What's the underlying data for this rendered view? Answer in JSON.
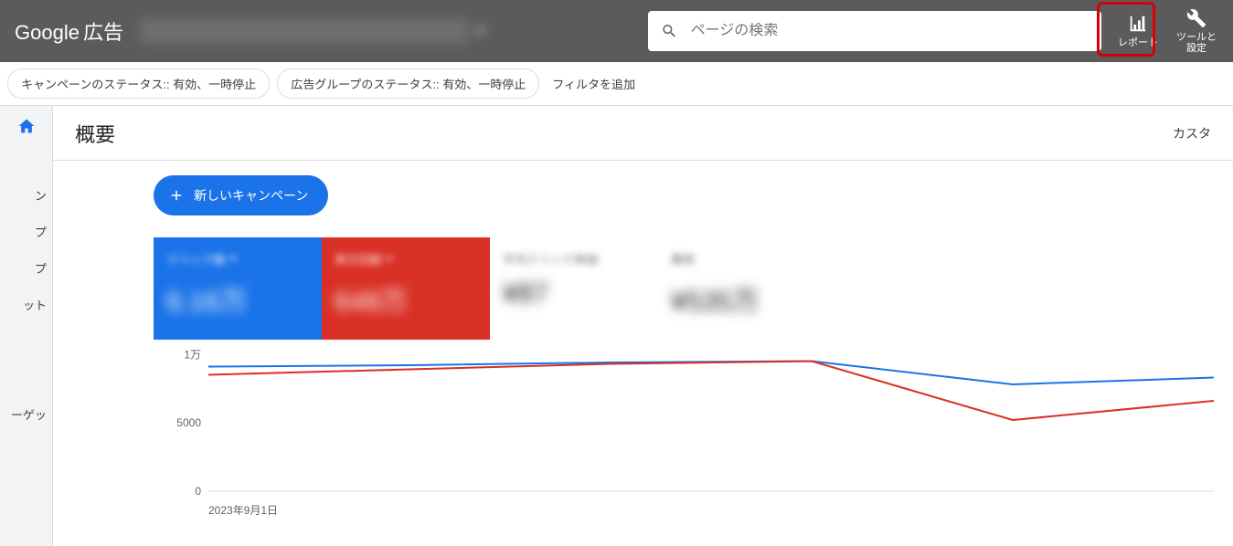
{
  "header": {
    "logo_google": "Google",
    "logo_ads": "広告",
    "search_placeholder": "ページの検索",
    "reports_label": "レポート",
    "tools_label": "ツールと\n設定"
  },
  "filters": {
    "chip_campaign": "キャンペーンのステータス:: 有効、一時停止",
    "chip_adgroup": "広告グループのステータス:: 有効、一時停止",
    "add_filter": "フィルタを追加"
  },
  "rail": {
    "items": [
      "ン",
      "プ",
      "プ",
      "ット",
      "ーゲッ"
    ]
  },
  "page": {
    "title": "概要",
    "customize": "カスタ",
    "new_campaign": "新しいキャンペーン"
  },
  "cards": [
    {
      "label": "クリック数",
      "value": "6.16万",
      "variant": "blue"
    },
    {
      "label": "表示回数",
      "value": "648万",
      "variant": "red"
    },
    {
      "label": "平均クリック単価",
      "value": "¥87",
      "variant": "white"
    },
    {
      "label": "費用",
      "value": "¥535万",
      "variant": "white"
    }
  ],
  "chart_data": {
    "type": "line",
    "ylim": [
      0,
      10000
    ],
    "y_ticks": [
      {
        "value": 10000,
        "label": "1万"
      },
      {
        "value": 5000,
        "label": "5000"
      },
      {
        "value": 0,
        "label": "0"
      }
    ],
    "x_label_first": "2023年9月1日",
    "x": [
      0,
      1,
      2,
      3,
      4,
      5
    ],
    "series": [
      {
        "name": "クリック数",
        "color": "#1a73e8",
        "values": [
          9100,
          9200,
          9400,
          9500,
          7800,
          8300
        ]
      },
      {
        "name": "表示回数",
        "color": "#d93025",
        "values": [
          8500,
          8900,
          9300,
          9500,
          5200,
          6600
        ]
      }
    ]
  }
}
